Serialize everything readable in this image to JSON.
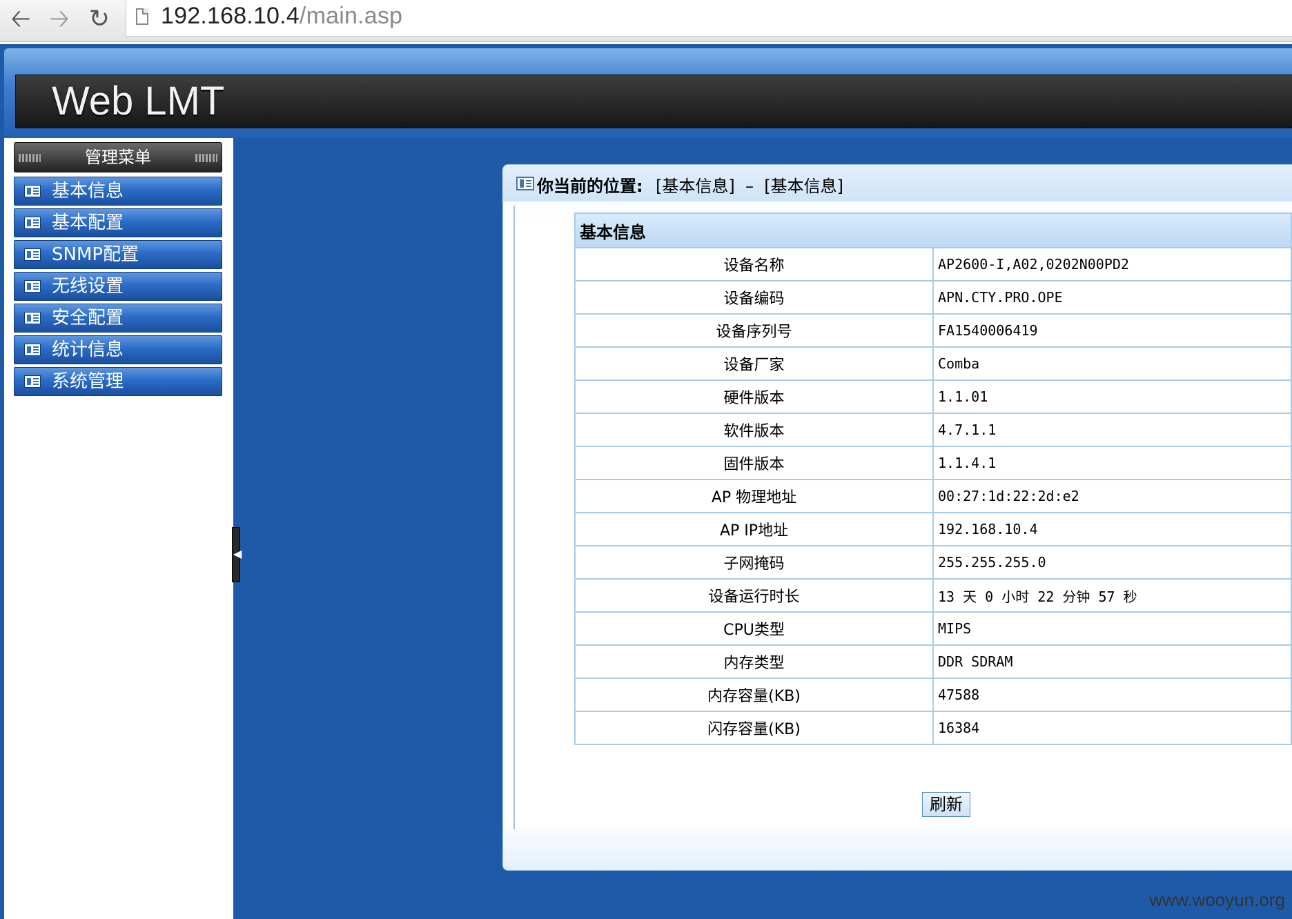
{
  "browser": {
    "url_host": "192.168.10.4",
    "url_path": "/main.asp",
    "back_glyph": "🡠",
    "forward_glyph": "🡢",
    "reload_glyph": "↻"
  },
  "header": {
    "title": "Web LMT"
  },
  "sidebar": {
    "menu_title": "管理菜单",
    "items": [
      {
        "label": "基本信息"
      },
      {
        "label": "基本配置"
      },
      {
        "label": "SNMP配置"
      },
      {
        "label": "无线设置"
      },
      {
        "label": "安全配置"
      },
      {
        "label": "统计信息"
      },
      {
        "label": "系统管理"
      }
    ],
    "collapse_glyph": "◀"
  },
  "breadcrumb": {
    "label": "你当前的位置:",
    "path": "[基本信息]  –  [基本信息]"
  },
  "info": {
    "section_title": "基本信息",
    "rows": [
      {
        "label": "设备名称",
        "value": "AP2600-I,A02,0202N00PD2"
      },
      {
        "label": "设备编码",
        "value": "APN.CTY.PRO.OPE"
      },
      {
        "label": "设备序列号",
        "value": "FA1540006419"
      },
      {
        "label": "设备厂家",
        "value": "Comba"
      },
      {
        "label": "硬件版本",
        "value": "1.1.01"
      },
      {
        "label": "软件版本",
        "value": "4.7.1.1"
      },
      {
        "label": "固件版本",
        "value": "1.1.4.1"
      },
      {
        "label": "AP 物理地址",
        "value": "00:27:1d:22:2d:e2"
      },
      {
        "label": "AP IP地址",
        "value": "192.168.10.4"
      },
      {
        "label": "子网掩码",
        "value": "255.255.255.0"
      },
      {
        "label": "设备运行时长",
        "value": "13 天 0 小时 22 分钟 57 秒"
      },
      {
        "label": "CPU类型",
        "value": "MIPS"
      },
      {
        "label": "内存类型",
        "value": "DDR SDRAM"
      },
      {
        "label": "内存容量(KB)",
        "value": "47588"
      },
      {
        "label": "闪存容量(KB)",
        "value": "16384"
      }
    ],
    "refresh_label": "刷新"
  },
  "watermark": "www.wooyun.org"
}
